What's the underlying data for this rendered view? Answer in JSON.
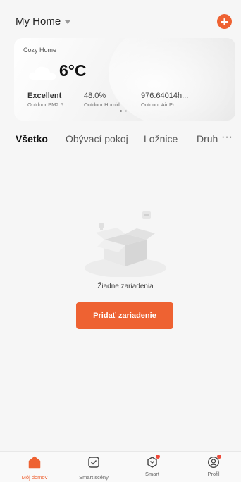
{
  "header": {
    "home_name": "My Home",
    "add_label": "+"
  },
  "weather": {
    "home_label": "Cozy Home",
    "icon": "cloud-icon",
    "temperature": "6°C",
    "metrics": [
      {
        "value": "Excellent",
        "label": "Outdoor PM2.5"
      },
      {
        "value": "48.0%",
        "label": "Outdoor Humid..."
      },
      {
        "value": "976.64014h...",
        "label": "Outdoor Air Pr..."
      }
    ],
    "page_count": 2,
    "active_page": 1
  },
  "tabs": [
    {
      "label": "Všetko",
      "active": true
    },
    {
      "label": "Obývací pokoj",
      "active": false
    },
    {
      "label": "Ložnice",
      "active": false
    },
    {
      "label": "Druh",
      "active": false
    }
  ],
  "more_label": "···",
  "empty_state": {
    "message": "Žiadne zariadenia",
    "button_label": "Pridať zariadenie"
  },
  "bottom_nav": [
    {
      "label": "Môj domov",
      "icon": "home-icon",
      "active": true
    },
    {
      "label": "Smart scény",
      "icon": "check-square-icon",
      "active": false
    },
    {
      "label": "Smart",
      "icon": "smart-icon",
      "active": false,
      "badge": true
    },
    {
      "label": "Profil",
      "icon": "profile-icon",
      "active": false,
      "badge": true
    }
  ],
  "colors": {
    "accent": "#ee6232",
    "background": "#f6f6f6",
    "badge": "#ee4a3a"
  }
}
